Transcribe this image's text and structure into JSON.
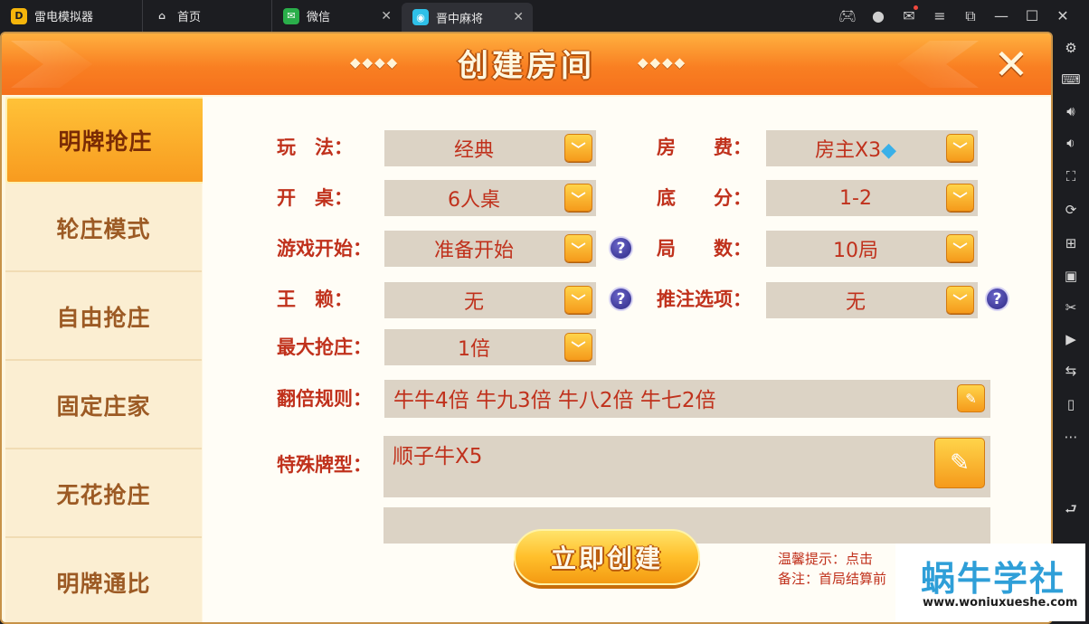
{
  "tabs": [
    {
      "label": "雷电模拟器",
      "icon": "leidian-logo-icon"
    },
    {
      "label": "首页",
      "icon": "home-icon"
    },
    {
      "label": "微信",
      "icon": "wechat-icon"
    },
    {
      "label": "晋中麻将",
      "icon": "game-app-icon",
      "active": true
    }
  ],
  "dialog": {
    "title": "创建房间",
    "deco_left": "◆◆◆◆",
    "deco_right": "◆◆◆◆"
  },
  "modes": [
    "明牌抢庄",
    "轮庄模式",
    "自由抢庄",
    "固定庄家",
    "无花抢庄",
    "明牌通比"
  ],
  "active_mode": "明牌抢庄",
  "form": {
    "wanfa": {
      "label": "玩　法：",
      "value": "经典"
    },
    "fangfei": {
      "label": "房　　费：",
      "value": "房主X3"
    },
    "kaizhuo": {
      "label": "开　桌：",
      "value": "6人桌"
    },
    "difen": {
      "label": "底　　分：",
      "value": "1-2"
    },
    "kaishi": {
      "label": "游戏开始：",
      "value": "准备开始"
    },
    "jushu": {
      "label": "局　　数：",
      "value": "10局"
    },
    "wanglai": {
      "label": "王　赖：",
      "value": "无"
    },
    "tuizhu": {
      "label": "推注选项：",
      "value": "无"
    },
    "qiangzhuang": {
      "label": "最大抢庄：",
      "value": "1倍"
    },
    "fanbei": {
      "label": "翻倍规则：",
      "value": "牛牛4倍 牛九3倍 牛八2倍 牛七2倍"
    },
    "teshu": {
      "label": "特殊牌型：",
      "value": "顺子牛X5"
    }
  },
  "create_button": "立即创建",
  "tips": {
    "line1": "温馨提示：点击",
    "line2": "备注：首局结算前"
  },
  "watermark": {
    "cn": "蜗牛学社",
    "en": "www.woniuxueshe.com"
  },
  "colors": {
    "label_red": "#c0311c",
    "header_orange": "#f97f22",
    "nav_text": "#9c5a24"
  }
}
